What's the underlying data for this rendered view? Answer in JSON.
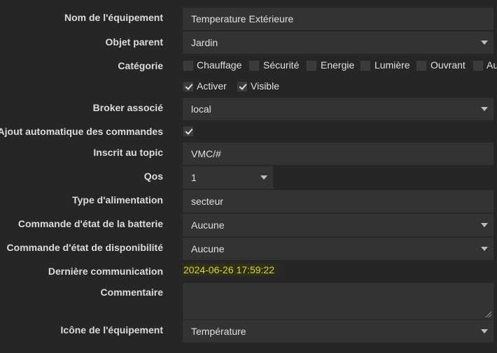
{
  "form": {
    "name_label": "Nom de l'équipement",
    "name_value": "Temperature Extérieure",
    "parent_label": "Objet parent",
    "parent_value": "Jardin",
    "category_label": "Catégorie",
    "categories": [
      "Chauffage",
      "Sécurité",
      "Energie",
      "Lumière",
      "Ouvrant",
      "Au"
    ],
    "activate_label": "Activer",
    "visible_label": "Visible",
    "broker_label": "Broker associé",
    "broker_value": "local",
    "auto_add_label": "Ajout automatique des commandes",
    "topic_label": "Inscrit au topic",
    "topic_value": "VMC/#",
    "qos_label": "Qos",
    "qos_value": "1",
    "power_label": "Type d'alimentation",
    "power_value": "secteur",
    "battery_cmd_label": "Commande d'état de la batterie",
    "battery_cmd_value": "Aucune",
    "avail_cmd_label": "Commande d'état de disponibilité",
    "avail_cmd_value": "Aucune",
    "last_comm_label": "Dernière communication",
    "last_comm_value": "2024-06-26 17:59:22",
    "comment_label": "Commentaire",
    "comment_value": "",
    "icon_label": "Icône de l'équipement",
    "icon_value": "Température"
  },
  "colors": {
    "background": "#262626",
    "field": "#333333",
    "highlight_text": "#d8d82a"
  }
}
